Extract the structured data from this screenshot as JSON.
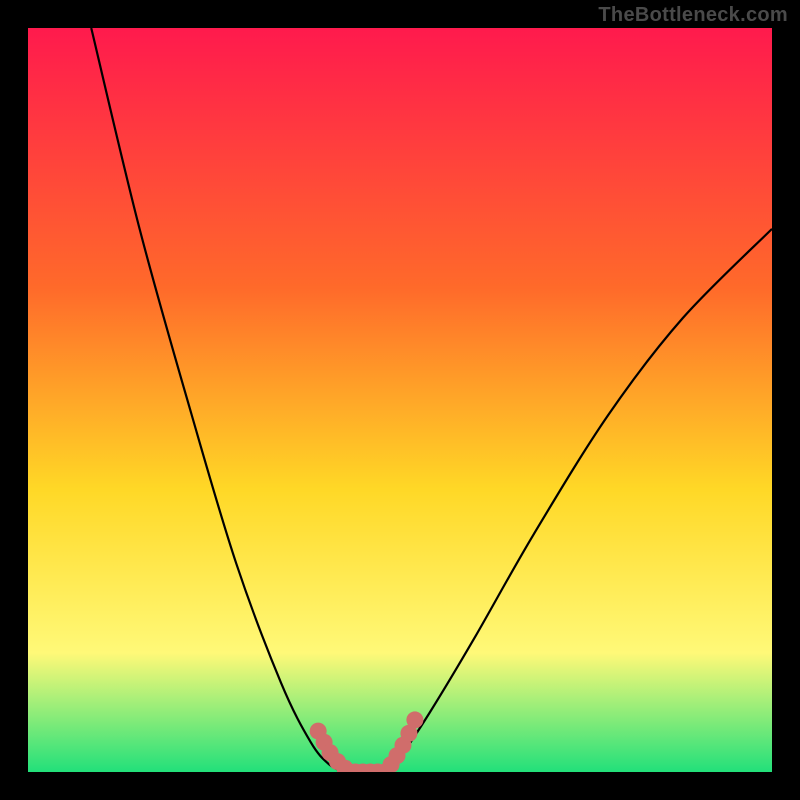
{
  "watermark": "TheBottleneck.com",
  "colors": {
    "frame": "#000000",
    "watermark_text": "#4a4a4a",
    "gradient_top": "#ff1a4d",
    "gradient_mid1": "#ff6a2a",
    "gradient_mid2": "#ffd826",
    "gradient_mid3": "#fff978",
    "gradient_bottom": "#22e07a",
    "curve_stroke": "#000000",
    "marker_fill": "#d06d6b"
  },
  "chart_data": {
    "type": "line",
    "title": "",
    "xlabel": "",
    "ylabel": "",
    "x_range": [
      0,
      100
    ],
    "y_range": [
      0,
      100
    ],
    "curve_left": {
      "name": "left-branch",
      "x": [
        8.5,
        15,
        22,
        28,
        34,
        38,
        40.5,
        42.5
      ],
      "y": [
        100,
        73,
        48,
        28,
        12,
        4,
        1,
        0
      ]
    },
    "curve_right": {
      "name": "right-branch",
      "x": [
        48,
        50,
        54,
        60,
        68,
        78,
        88,
        100
      ],
      "y": [
        0,
        2,
        8,
        18,
        32,
        48,
        61,
        73
      ]
    },
    "flat_bottom": {
      "name": "valley-floor",
      "x": [
        42.5,
        48
      ],
      "y": [
        0,
        0
      ]
    },
    "markers_left": {
      "name": "markers-left",
      "points": [
        {
          "x": 39.0,
          "y": 5.5
        },
        {
          "x": 39.8,
          "y": 4.0
        },
        {
          "x": 40.6,
          "y": 2.6
        },
        {
          "x": 41.6,
          "y": 1.4
        },
        {
          "x": 42.6,
          "y": 0.5
        },
        {
          "x": 44.0,
          "y": 0.0
        }
      ]
    },
    "markers_right": {
      "name": "markers-right",
      "points": [
        {
          "x": 48.0,
          "y": 0.0
        },
        {
          "x": 48.8,
          "y": 1.0
        },
        {
          "x": 49.6,
          "y": 2.2
        },
        {
          "x": 50.4,
          "y": 3.6
        },
        {
          "x": 51.2,
          "y": 5.2
        },
        {
          "x": 52.0,
          "y": 7.0
        }
      ]
    },
    "markers_floor": {
      "name": "markers-floor",
      "points": [
        {
          "x": 45.0,
          "y": 0.0
        },
        {
          "x": 46.0,
          "y": 0.0
        },
        {
          "x": 47.0,
          "y": 0.0
        }
      ]
    }
  }
}
